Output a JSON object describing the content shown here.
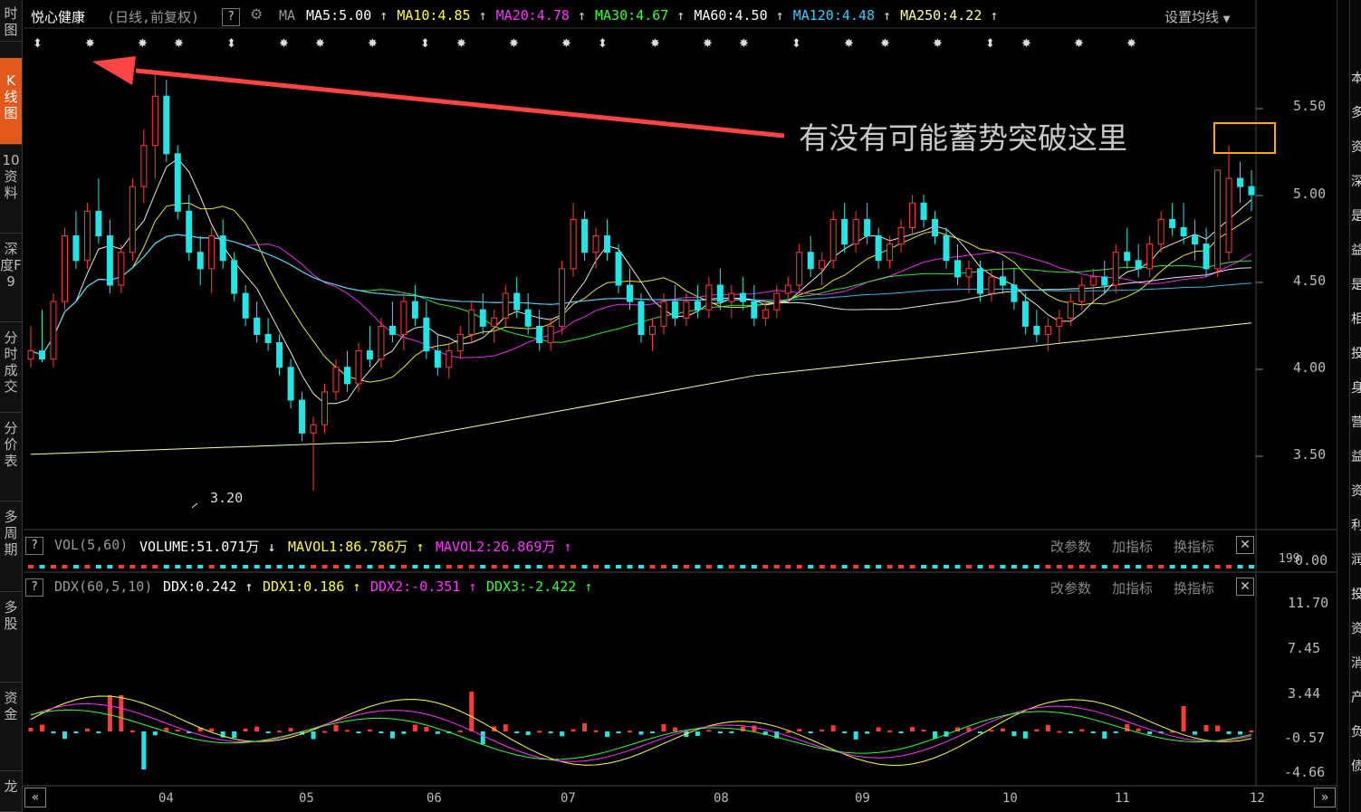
{
  "left_tabs": [
    {
      "label": "时图",
      "active": false
    },
    {
      "label": "K线图",
      "active": true
    },
    {
      "label": "10资料",
      "active": false
    },
    {
      "label": "深度F9",
      "active": false
    },
    {
      "label": "分时成交",
      "active": false
    },
    {
      "label": "分价表",
      "active": false
    },
    {
      "label": "多周期",
      "active": false
    },
    {
      "label": "多股",
      "active": false
    },
    {
      "label": "资金",
      "active": false
    },
    {
      "label": "龙",
      "active": false
    }
  ],
  "header": {
    "stock_name": "悦心健康",
    "mode": "(日线,前复权)",
    "help": "?",
    "ma_label": "MA",
    "settings": "设置均线",
    "ma_items": [
      {
        "text": "MA5:5.00",
        "arrow": "↑",
        "color": "#ffffff"
      },
      {
        "text": "MA10:4.85",
        "arrow": "↑",
        "color": "#ffff33"
      },
      {
        "text": "MA20:4.78",
        "arrow": "↑",
        "color": "#ff33ff"
      },
      {
        "text": "MA30:4.67",
        "arrow": "↑",
        "color": "#33ff33"
      },
      {
        "text": "MA60:4.50",
        "arrow": "↑",
        "color": "#ffffff"
      },
      {
        "text": "MA120:4.48",
        "arrow": "↑",
        "color": "#33ccff"
      },
      {
        "text": "MA250:4.22",
        "arrow": "↑",
        "color": "#ffff99"
      }
    ]
  },
  "annotation": {
    "text": "有没有可能蓄势突破这里",
    "color": "#ff4444"
  },
  "price_axis": [
    "5.50",
    "5.00",
    "4.50",
    "4.00",
    "3.50"
  ],
  "low_label": "3.20",
  "vol_panel": {
    "name": "VOL(5,60)",
    "volume": "VOLUME:51.071万",
    "volume_arrow": "↓",
    "mavol1": "MAVOL1:86.786万",
    "mavol1_arrow": "↑",
    "mavol2": "MAVOL2:26.869万",
    "mavol2_arrow": "↑",
    "axis": "0.00",
    "axis2": "199"
  },
  "ddx_panel": {
    "name": "DDX(60,5,10)",
    "ddx": "DDX:0.242",
    "ddx_arrow": "↑",
    "ddx1": "DDX1:0.186",
    "ddx1_arrow": "↑",
    "ddx2": "DDX2:-0.351",
    "ddx2_arrow": "↑",
    "ddx3": "DDX3:-2.422",
    "ddx3_arrow": "↑",
    "axis": [
      "11.70",
      "7.45",
      "3.44",
      "-0.57",
      "-4.66"
    ]
  },
  "panel_buttons": {
    "modify": "改参数",
    "add": "加指标",
    "switch": "换指标",
    "close": "✕"
  },
  "months": [
    "04",
    "05",
    "06",
    "07",
    "08",
    "09",
    "10",
    "11",
    "12"
  ],
  "nav": {
    "prev": "«",
    "next": "»"
  },
  "colors": {
    "up": "#ff3b3b",
    "down": "#22e6e6",
    "annotation_box": "#ffaa00"
  },
  "chart_data": {
    "type": "candlestick",
    "ylim": [
      3.1,
      5.8
    ],
    "note_high": 5.75,
    "note_low": 3.2,
    "candles": [
      [
        4.0,
        4.2,
        3.95,
        4.05
      ],
      [
        4.05,
        4.3,
        3.98,
        4.0
      ],
      [
        4.0,
        4.4,
        3.95,
        4.35
      ],
      [
        4.35,
        4.8,
        4.3,
        4.75
      ],
      [
        4.75,
        4.9,
        4.55,
        4.6
      ],
      [
        4.6,
        4.95,
        4.55,
        4.9
      ],
      [
        4.9,
        5.1,
        4.7,
        4.75
      ],
      [
        4.75,
        4.85,
        4.4,
        4.45
      ],
      [
        4.45,
        4.7,
        4.4,
        4.65
      ],
      [
        4.65,
        5.1,
        4.6,
        5.05
      ],
      [
        5.05,
        5.4,
        4.95,
        5.3
      ],
      [
        5.3,
        5.75,
        5.1,
        5.6
      ],
      [
        5.6,
        5.7,
        5.2,
        5.25
      ],
      [
        5.25,
        5.3,
        4.85,
        4.9
      ],
      [
        4.9,
        5.0,
        4.6,
        4.65
      ],
      [
        4.65,
        4.75,
        4.45,
        4.55
      ],
      [
        4.55,
        4.8,
        4.4,
        4.75
      ],
      [
        4.75,
        4.85,
        4.55,
        4.6
      ],
      [
        4.6,
        4.65,
        4.35,
        4.4
      ],
      [
        4.4,
        4.45,
        4.2,
        4.25
      ],
      [
        4.25,
        4.35,
        4.1,
        4.15
      ],
      [
        4.15,
        4.25,
        4.05,
        4.1
      ],
      [
        4.1,
        4.15,
        3.9,
        3.95
      ],
      [
        3.95,
        4.0,
        3.7,
        3.75
      ],
      [
        3.75,
        3.8,
        3.5,
        3.55
      ],
      [
        3.55,
        3.65,
        3.2,
        3.6
      ],
      [
        3.6,
        3.85,
        3.55,
        3.8
      ],
      [
        3.8,
        4.0,
        3.75,
        3.95
      ],
      [
        3.95,
        4.05,
        3.8,
        3.85
      ],
      [
        3.85,
        4.1,
        3.8,
        4.05
      ],
      [
        4.05,
        4.2,
        3.95,
        4.0
      ],
      [
        4.0,
        4.25,
        3.95,
        4.2
      ],
      [
        4.2,
        4.35,
        4.1,
        4.15
      ],
      [
        4.15,
        4.4,
        4.05,
        4.35
      ],
      [
        4.35,
        4.45,
        4.2,
        4.25
      ],
      [
        4.25,
        4.35,
        4.0,
        4.05
      ],
      [
        4.05,
        4.15,
        3.9,
        3.95
      ],
      [
        3.95,
        4.1,
        3.88,
        4.05
      ],
      [
        4.05,
        4.2,
        4.0,
        4.15
      ],
      [
        4.15,
        4.35,
        4.1,
        4.3
      ],
      [
        4.3,
        4.4,
        4.15,
        4.2
      ],
      [
        4.2,
        4.3,
        4.1,
        4.25
      ],
      [
        4.25,
        4.45,
        4.2,
        4.4
      ],
      [
        4.4,
        4.5,
        4.25,
        4.3
      ],
      [
        4.3,
        4.4,
        4.15,
        4.2
      ],
      [
        4.2,
        4.3,
        4.05,
        4.1
      ],
      [
        4.1,
        4.25,
        4.05,
        4.2
      ],
      [
        4.2,
        4.6,
        4.15,
        4.55
      ],
      [
        4.55,
        4.95,
        4.5,
        4.85
      ],
      [
        4.85,
        4.9,
        4.6,
        4.65
      ],
      [
        4.65,
        4.8,
        4.55,
        4.75
      ],
      [
        4.75,
        4.85,
        4.6,
        4.65
      ],
      [
        4.65,
        4.7,
        4.4,
        4.45
      ],
      [
        4.45,
        4.55,
        4.3,
        4.35
      ],
      [
        4.35,
        4.4,
        4.1,
        4.15
      ],
      [
        4.15,
        4.25,
        4.05,
        4.2
      ],
      [
        4.2,
        4.4,
        4.15,
        4.35
      ],
      [
        4.35,
        4.45,
        4.2,
        4.25
      ],
      [
        4.25,
        4.4,
        4.2,
        4.35
      ],
      [
        4.35,
        4.45,
        4.25,
        4.3
      ],
      [
        4.3,
        4.5,
        4.25,
        4.45
      ],
      [
        4.45,
        4.55,
        4.3,
        4.35
      ],
      [
        4.35,
        4.45,
        4.25,
        4.4
      ],
      [
        4.4,
        4.5,
        4.3,
        4.35
      ],
      [
        4.35,
        4.45,
        4.2,
        4.25
      ],
      [
        4.25,
        4.35,
        4.2,
        4.3
      ],
      [
        4.3,
        4.45,
        4.25,
        4.4
      ],
      [
        4.4,
        4.5,
        4.35,
        4.45
      ],
      [
        4.45,
        4.7,
        4.4,
        4.65
      ],
      [
        4.65,
        4.75,
        4.5,
        4.55
      ],
      [
        4.55,
        4.65,
        4.45,
        4.6
      ],
      [
        4.6,
        4.9,
        4.55,
        4.85
      ],
      [
        4.85,
        4.95,
        4.65,
        4.7
      ],
      [
        4.7,
        4.9,
        4.65,
        4.85
      ],
      [
        4.85,
        4.95,
        4.7,
        4.75
      ],
      [
        4.75,
        4.8,
        4.55,
        4.6
      ],
      [
        4.6,
        4.75,
        4.55,
        4.7
      ],
      [
        4.7,
        4.85,
        4.65,
        4.8
      ],
      [
        4.8,
        5.0,
        4.75,
        4.95
      ],
      [
        4.95,
        5.0,
        4.8,
        4.85
      ],
      [
        4.85,
        4.9,
        4.7,
        4.75
      ],
      [
        4.75,
        4.8,
        4.55,
        4.6
      ],
      [
        4.6,
        4.7,
        4.45,
        4.5
      ],
      [
        4.5,
        4.6,
        4.4,
        4.55
      ],
      [
        4.55,
        4.6,
        4.35,
        4.4
      ],
      [
        4.4,
        4.55,
        4.35,
        4.5
      ],
      [
        4.5,
        4.6,
        4.4,
        4.45
      ],
      [
        4.45,
        4.55,
        4.3,
        4.35
      ],
      [
        4.35,
        4.4,
        4.15,
        4.2
      ],
      [
        4.2,
        4.3,
        4.1,
        4.15
      ],
      [
        4.15,
        4.25,
        4.05,
        4.2
      ],
      [
        4.2,
        4.3,
        4.1,
        4.25
      ],
      [
        4.25,
        4.4,
        4.2,
        4.35
      ],
      [
        4.35,
        4.5,
        4.3,
        4.45
      ],
      [
        4.45,
        4.55,
        4.35,
        4.5
      ],
      [
        4.5,
        4.6,
        4.4,
        4.45
      ],
      [
        4.45,
        4.7,
        4.4,
        4.65
      ],
      [
        4.65,
        4.8,
        4.55,
        4.6
      ],
      [
        4.6,
        4.7,
        4.5,
        4.55
      ],
      [
        4.55,
        4.75,
        4.5,
        4.7
      ],
      [
        4.7,
        4.9,
        4.65,
        4.85
      ],
      [
        4.85,
        4.95,
        4.75,
        4.8
      ],
      [
        4.8,
        4.95,
        4.7,
        4.75
      ],
      [
        4.75,
        4.85,
        4.6,
        4.7
      ],
      [
        4.7,
        4.8,
        4.5,
        4.55
      ],
      [
        4.55,
        4.75,
        4.5,
        5.15
      ],
      [
        4.65,
        5.3,
        4.6,
        5.1
      ],
      [
        5.1,
        5.2,
        4.95,
        5.05
      ],
      [
        5.05,
        5.15,
        4.9,
        5.0
      ]
    ]
  }
}
